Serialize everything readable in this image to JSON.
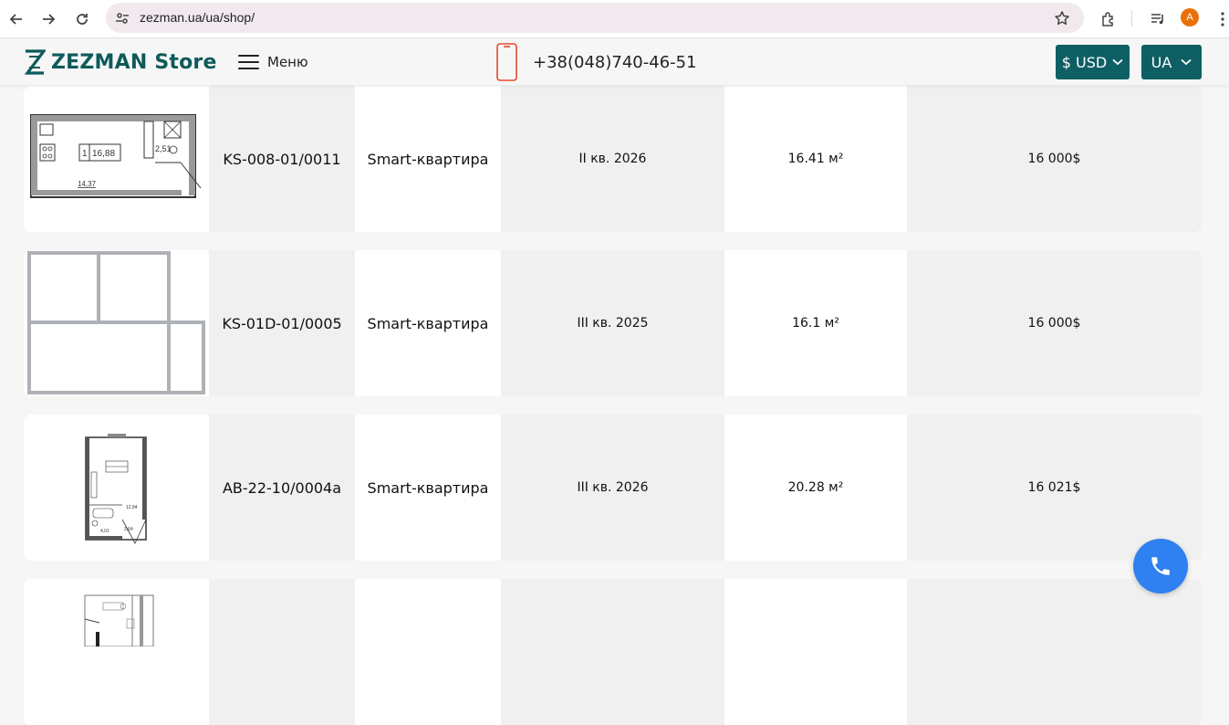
{
  "browser": {
    "url": "zezman.ua/ua/shop/",
    "avatar_letter": "A"
  },
  "header": {
    "logo_text": "ZEZMAN Store",
    "menu_label": "Меню",
    "phone": "+38(048)740-46-51",
    "currency_label": "$ USD",
    "language_label": "UA",
    "brand_color": "#0e5f63",
    "phone_icon_color": "#e8472d"
  },
  "listings": [
    {
      "code": "KS-008-01/0011",
      "type": "Smart-квартира",
      "quarter": "II кв. 2026",
      "area": "16.41 м²",
      "price": "16 000$",
      "plan_labels": [
        "1",
        "16,88",
        "2,51",
        "14,37"
      ]
    },
    {
      "code": "KS-01D-01/0005",
      "type": "Smart-квартира",
      "quarter": "III кв. 2025",
      "area": "16.1 м²",
      "price": "16 000$",
      "plan_labels": []
    },
    {
      "code": "AB-22-10/0004a",
      "type": "Smart-квартира",
      "quarter": "III кв. 2026",
      "area": "20.28 м²",
      "price": "16 021$",
      "plan_labels": [
        "12,84",
        "4,01",
        "2,64"
      ]
    },
    {
      "code": "",
      "type": "",
      "quarter": "",
      "area": "",
      "price": "",
      "plan_labels": []
    }
  ],
  "call_button_color": "#2f80f0"
}
